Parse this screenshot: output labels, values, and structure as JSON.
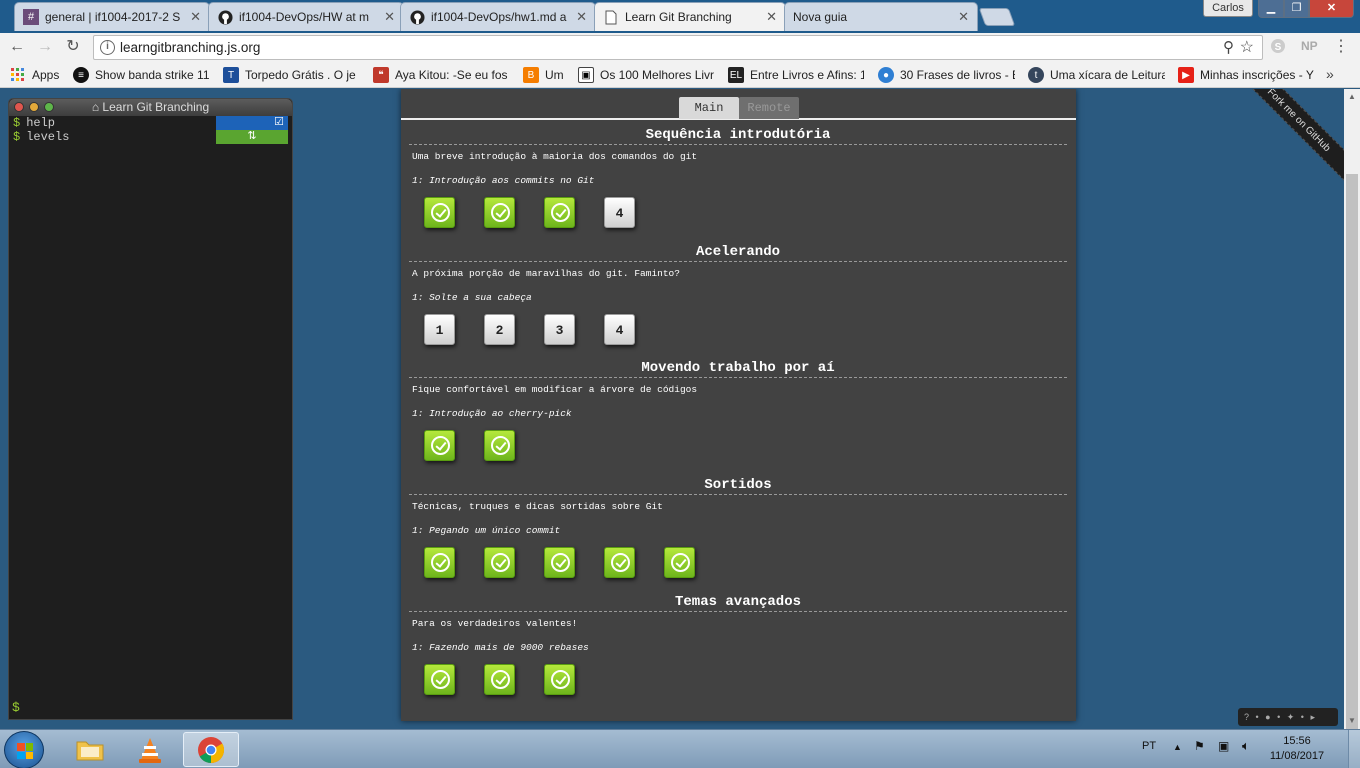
{
  "tabs": [
    {
      "title": "general | if1004-2017-2 S",
      "icon": "hash-icon"
    },
    {
      "title": "if1004-DevOps/HW at m",
      "icon": "github-icon"
    },
    {
      "title": "if1004-DevOps/hw1.md a",
      "icon": "github-icon"
    },
    {
      "title": "Learn Git Branching",
      "icon": "page-icon",
      "active": true
    },
    {
      "title": "Nova guia",
      "icon": ""
    }
  ],
  "window": {
    "user": "Carlos"
  },
  "address": {
    "url": "learngitbranching.js.org"
  },
  "extensions": {
    "np": "NP"
  },
  "bookmarks": [
    {
      "label": "Apps"
    },
    {
      "label": "Show banda strike 11"
    },
    {
      "label": "Torpedo Grátis . O je"
    },
    {
      "label": "Aya Kitou: -Se eu fos"
    },
    {
      "label": "Um"
    },
    {
      "label": "Os 100 Melhores Livr"
    },
    {
      "label": "Entre Livros e Afins: 1"
    },
    {
      "label": "30 Frases de livros - E"
    },
    {
      "label": "Uma xícara de Leitura"
    },
    {
      "label": "Minhas inscrições - Y"
    }
  ],
  "terminal": {
    "title": "Learn Git Branching",
    "lines": [
      {
        "cmd": "help"
      },
      {
        "cmd": "levels",
        "badge": "⇅"
      }
    ],
    "prompt": "$"
  },
  "dialog": {
    "tab_main": "Main",
    "tab_remote": "Remote",
    "sequences": [
      {
        "title": "Sequência introdutória",
        "desc": "Uma breve introdução à maioria dos comandos do git",
        "sub": "1: Introdução aos commits no Git",
        "levels": [
          {
            "done": true,
            "label": ""
          },
          {
            "done": true,
            "label": ""
          },
          {
            "done": true,
            "label": ""
          },
          {
            "done": false,
            "label": "4"
          }
        ]
      },
      {
        "title": "Acelerando",
        "desc": "A próxima porção de maravilhas do git. Faminto?",
        "sub": "1: Solte a sua cabeça",
        "levels": [
          {
            "done": false,
            "label": "1"
          },
          {
            "done": false,
            "label": "2"
          },
          {
            "done": false,
            "label": "3"
          },
          {
            "done": false,
            "label": "4"
          }
        ]
      },
      {
        "title": "Movendo trabalho por aí",
        "desc": "Fique confortável em modificar a árvore de códigos",
        "sub": "1: Introdução ao cherry-pick",
        "levels": [
          {
            "done": true,
            "label": ""
          },
          {
            "done": true,
            "label": ""
          }
        ]
      },
      {
        "title": "Sortidos",
        "desc": "Técnicas, truques e dicas sortidas sobre Git",
        "sub": "1: Pegando um único commit",
        "levels": [
          {
            "done": true,
            "label": ""
          },
          {
            "done": true,
            "label": ""
          },
          {
            "done": true,
            "label": ""
          },
          {
            "done": true,
            "label": ""
          },
          {
            "done": true,
            "label": ""
          }
        ]
      },
      {
        "title": "Temas avançados",
        "desc": "Para os verdadeiros valentes!",
        "sub": "1: Fazendo mais de 9000 rebases",
        "levels": [
          {
            "done": true,
            "label": ""
          },
          {
            "done": true,
            "label": ""
          },
          {
            "done": true,
            "label": ""
          }
        ]
      }
    ]
  },
  "ribbon": {
    "label": "Fork me on GitHub"
  },
  "taskbar": {
    "lang": "PT",
    "time": "15:56",
    "date": "11/08/2017"
  }
}
